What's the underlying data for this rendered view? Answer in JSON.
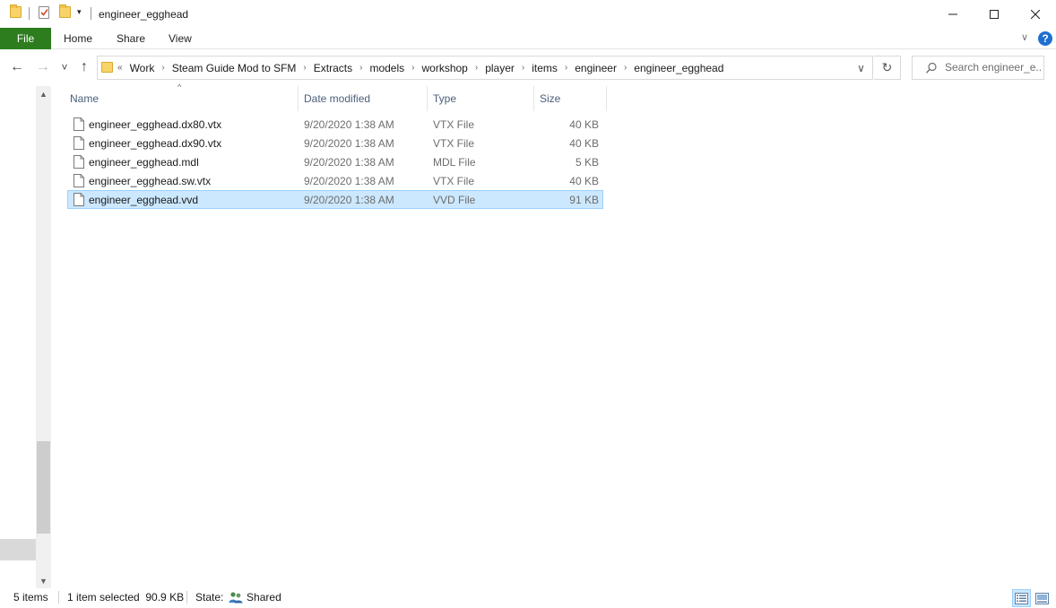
{
  "window": {
    "title": "engineer_egghead",
    "minimize_glyph": "—",
    "maximize_glyph": "☐",
    "close_glyph": "✕"
  },
  "quick_access": {
    "dropdown_glyph": "▾"
  },
  "ribbon": {
    "tabs": [
      {
        "label": "File"
      },
      {
        "label": "Home"
      },
      {
        "label": "Share"
      },
      {
        "label": "View"
      }
    ],
    "expand_glyph": "∨",
    "help_glyph": "?"
  },
  "navigation": {
    "back_glyph": "←",
    "forward_glyph": "→",
    "recent_glyph": "˅",
    "up_glyph": "↑",
    "overflow_glyph": "«",
    "breadcrumb_sep": "›",
    "breadcrumbs": [
      "Work",
      "Steam Guide Mod to SFM",
      "Extracts",
      "models",
      "workshop",
      "player",
      "items",
      "engineer",
      "engineer_egghead"
    ],
    "address_dropdown_glyph": "∨",
    "refresh_glyph": "↻",
    "search_placeholder": "Search engineer_e..."
  },
  "scrollbar": {
    "up_glyph": "▲",
    "down_glyph": "▼"
  },
  "file_list": {
    "sort_glyph": "^",
    "columns": {
      "name": "Name",
      "date_modified": "Date modified",
      "type": "Type",
      "size": "Size"
    },
    "files": [
      {
        "name": "engineer_egghead.dx80.vtx",
        "date": "9/20/2020 1:38 AM",
        "type": "VTX File",
        "size": "40 KB",
        "selected": false
      },
      {
        "name": "engineer_egghead.dx90.vtx",
        "date": "9/20/2020 1:38 AM",
        "type": "VTX File",
        "size": "40 KB",
        "selected": false
      },
      {
        "name": "engineer_egghead.mdl",
        "date": "9/20/2020 1:38 AM",
        "type": "MDL File",
        "size": "5 KB",
        "selected": false
      },
      {
        "name": "engineer_egghead.sw.vtx",
        "date": "9/20/2020 1:38 AM",
        "type": "VTX File",
        "size": "40 KB",
        "selected": false
      },
      {
        "name": "engineer_egghead.vvd",
        "date": "9/20/2020 1:38 AM",
        "type": "VVD File",
        "size": "91 KB",
        "selected": true
      }
    ]
  },
  "status": {
    "item_count": "5 items",
    "selection": "1 item selected  90.9 KB",
    "state_label": "State:",
    "state_value": "Shared"
  },
  "colors": {
    "file_tab": "#2d7d1f",
    "selection_bg": "#cce8ff",
    "selection_border": "#99d1ff",
    "help": "#1f6fd1",
    "folder": "#f8d36a"
  }
}
